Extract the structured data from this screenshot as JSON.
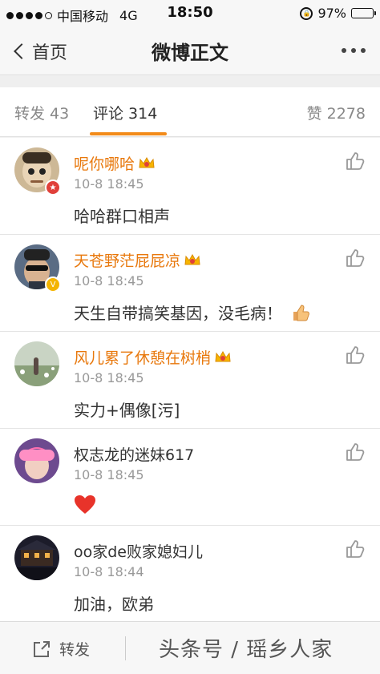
{
  "status_bar": {
    "carrier": "中国移动",
    "network": "4G",
    "time": "18:50",
    "battery_percent": "97%",
    "battery_level": 0.97,
    "signal_bars_filled": 4,
    "signal_bars_total": 5
  },
  "nav": {
    "back_label": "首页",
    "title": "微博正文"
  },
  "tabs": {
    "repost": "转发 43",
    "comments": "评论 314",
    "likes": "赞 2278"
  },
  "comments": [
    {
      "username": "呢你哪哈",
      "time": "10-8 18:45",
      "content": "哈哈群口相声",
      "vip": true,
      "badge": "red"
    },
    {
      "username": "天苍野茫屁屁凉",
      "time": "10-8 18:45",
      "content": "天生自带搞笑基因，没毛病！",
      "vip": true,
      "badge": "yellow",
      "emoji": "thumbs-up"
    },
    {
      "username": "风儿累了休憩在树梢",
      "time": "10-8 18:45",
      "content": "实力+偶像[污]",
      "vip": true
    },
    {
      "username": "权志龙的迷妹617",
      "time": "10-8 18:45",
      "content": "",
      "vip": false,
      "emoji": "heart"
    },
    {
      "username": "oo家de败家媳妇儿",
      "time": "10-8 18:44",
      "content": "加油，欧弟",
      "vip": false
    }
  ],
  "bottom": {
    "repost_label": "转发",
    "watermark": "头条号 / 瑶乡人家"
  },
  "colors": {
    "accent": "#f28b1a",
    "username_vip": "#e8780c"
  }
}
